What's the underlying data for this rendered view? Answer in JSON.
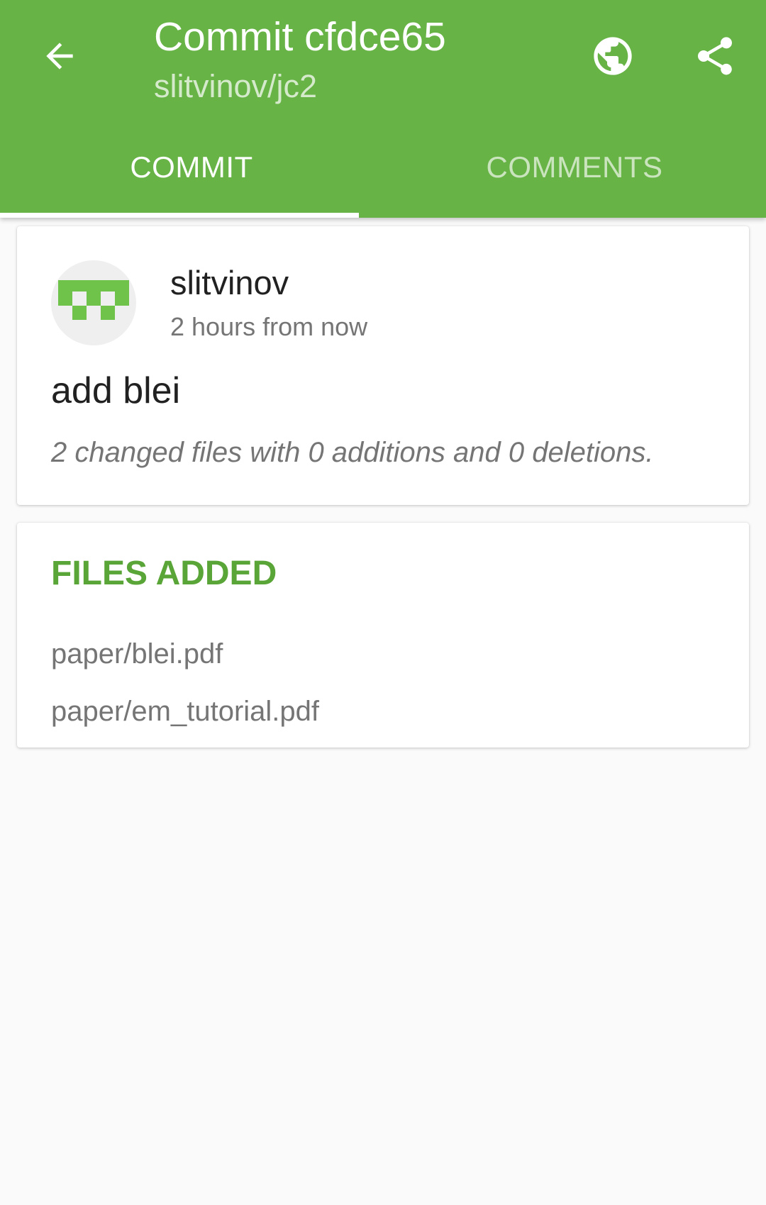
{
  "toolbar": {
    "title": "Commit cfdce65",
    "subtitle": "slitvinov/jc2",
    "back_icon": "arrow-back-icon",
    "globe_icon": "globe-icon",
    "share_icon": "share-icon"
  },
  "tabs": [
    {
      "label": "COMMIT",
      "selected": true
    },
    {
      "label": "COMMENTS",
      "selected": false
    }
  ],
  "commit": {
    "author": "slitvinov",
    "timestamp": "2 hours from now",
    "message": "add blei",
    "summary": "2 changed files with 0 additions and 0 deletions."
  },
  "files": {
    "header": "FILES ADDED",
    "items": [
      "paper/blei.pdf",
      "paper/em_tutorial.pdf"
    ]
  },
  "colors": {
    "primary": "#67b346",
    "accent_text": "#5aa537",
    "background": "#fafafa"
  }
}
